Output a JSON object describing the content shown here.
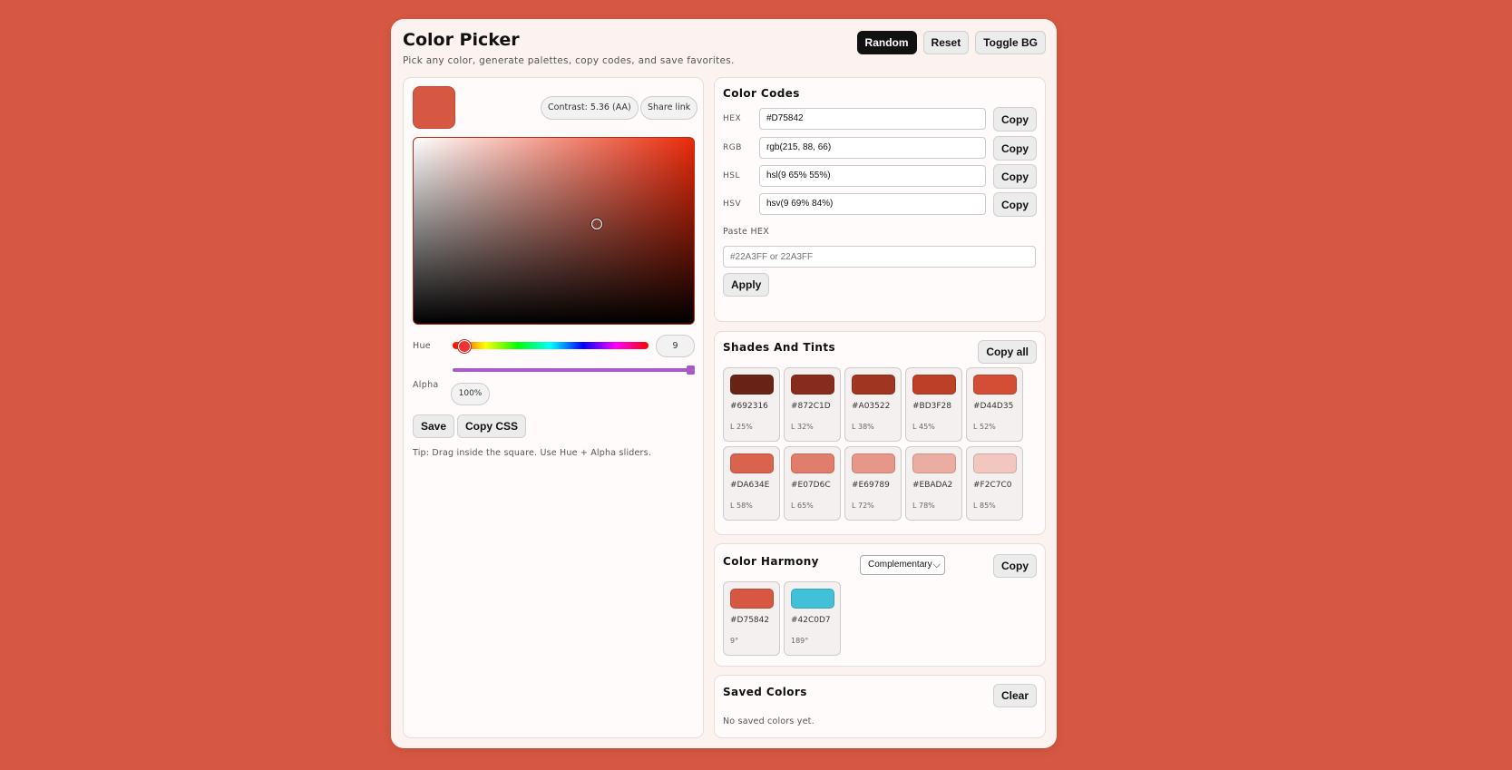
{
  "header": {
    "title": "Color Picker",
    "subtitle": "Pick any color, generate palettes, copy codes, and save favorites.",
    "buttons": {
      "random": "Random",
      "reset": "Reset",
      "toggle_bg": "Toggle BG"
    }
  },
  "picker": {
    "current_color": "#D75842",
    "contrast": "Contrast: 5.36 (AA)",
    "share": "Share link",
    "hue_label": "Hue",
    "hue_value": "9",
    "alpha_label": "Alpha",
    "alpha_value": "100%",
    "save": "Save",
    "copy_css": "Copy CSS",
    "tip": "Tip: Drag inside the square. Use Hue + Alpha sliders."
  },
  "codes": {
    "title": "Color Codes",
    "rows": [
      {
        "key": "HEX",
        "value": "#D75842",
        "button": "Copy"
      },
      {
        "key": "RGB",
        "value": "rgb(215, 88, 66)",
        "button": "Copy"
      },
      {
        "key": "HSL",
        "value": "hsl(9 65% 55%)",
        "button": "Copy"
      },
      {
        "key": "HSV",
        "value": "hsv(9 69% 84%)",
        "button": "Copy"
      }
    ],
    "paste_label": "Paste HEX",
    "paste_placeholder": "#22A3FF or 22A3FF",
    "apply": "Apply"
  },
  "shades": {
    "title": "Shades And Tints",
    "copy_all": "Copy all",
    "items": [
      {
        "hex": "#692316",
        "l": "L 25%"
      },
      {
        "hex": "#872C1D",
        "l": "L 32%"
      },
      {
        "hex": "#A03522",
        "l": "L 38%"
      },
      {
        "hex": "#BD3F28",
        "l": "L 45%"
      },
      {
        "hex": "#D44D35",
        "l": "L 52%"
      },
      {
        "hex": "#DA634E",
        "l": "L 58%"
      },
      {
        "hex": "#E07D6C",
        "l": "L 65%"
      },
      {
        "hex": "#E69789",
        "l": "L 72%"
      },
      {
        "hex": "#EBADA2",
        "l": "L 78%"
      },
      {
        "hex": "#F2C7C0",
        "l": "L 85%"
      }
    ]
  },
  "harmony": {
    "title": "Color Harmony",
    "mode": "Complementary",
    "copy": "Copy",
    "items": [
      {
        "hex": "#D75842",
        "deg": "9°"
      },
      {
        "hex": "#42C0D7",
        "deg": "189°"
      }
    ]
  },
  "saved": {
    "title": "Saved Colors",
    "clear": "Clear",
    "empty": "No saved colors yet."
  }
}
